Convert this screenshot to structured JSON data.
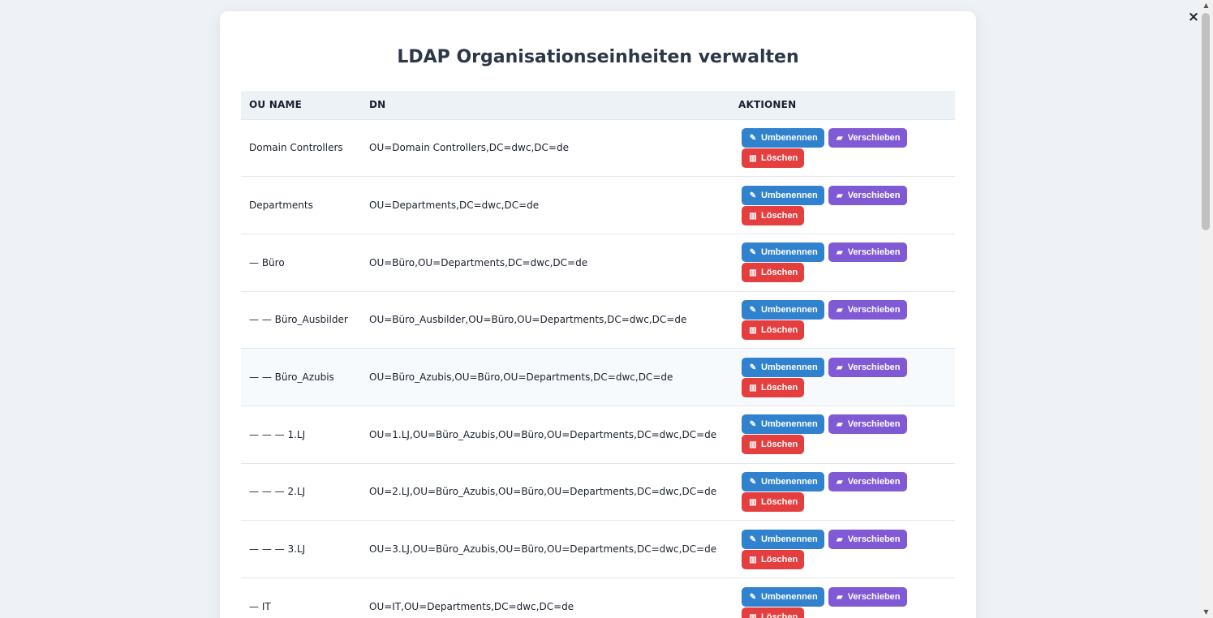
{
  "modal": {
    "title": "LDAP Organisationseinheiten verwalten",
    "close_label": "×"
  },
  "table": {
    "headers": {
      "ou_name": "OU NAME",
      "dn": "DN",
      "actions": "AKTIONEN"
    },
    "buttons": {
      "rename": "Umbenennen",
      "move": "Verschieben",
      "delete": "Löschen"
    },
    "icons": {
      "rename": "pencil-icon",
      "move": "folder-icon",
      "delete": "trash-icon"
    },
    "rows": [
      {
        "name": "Domain Controllers",
        "dn": "OU=Domain Controllers,DC=dwc,DC=de"
      },
      {
        "name": "Departments",
        "dn": "OU=Departments,DC=dwc,DC=de"
      },
      {
        "name": "— Büro",
        "dn": "OU=Büro,OU=Departments,DC=dwc,DC=de"
      },
      {
        "name": "— — Büro_Ausbilder",
        "dn": "OU=Büro_Ausbilder,OU=Büro,OU=Departments,DC=dwc,DC=de"
      },
      {
        "name": "— — Büro_Azubis",
        "dn": "OU=Büro_Azubis,OU=Büro,OU=Departments,DC=dwc,DC=de"
      },
      {
        "name": "— — — 1.LJ",
        "dn": "OU=1.LJ,OU=Büro_Azubis,OU=Büro,OU=Departments,DC=dwc,DC=de"
      },
      {
        "name": "— — — 2.LJ",
        "dn": "OU=2.LJ,OU=Büro_Azubis,OU=Büro,OU=Departments,DC=dwc,DC=de"
      },
      {
        "name": "— — — 3.LJ",
        "dn": "OU=3.LJ,OU=Büro_Azubis,OU=Büro,OU=Departments,DC=dwc,DC=de"
      },
      {
        "name": "— IT",
        "dn": "OU=IT,OU=Departments,DC=dwc,DC=de"
      }
    ]
  },
  "colors": {
    "rename": "#3182ce",
    "move": "#805ad5",
    "delete": "#e53e3e",
    "header_bg": "#edf2f7",
    "page_bg": "#eef1f5"
  }
}
